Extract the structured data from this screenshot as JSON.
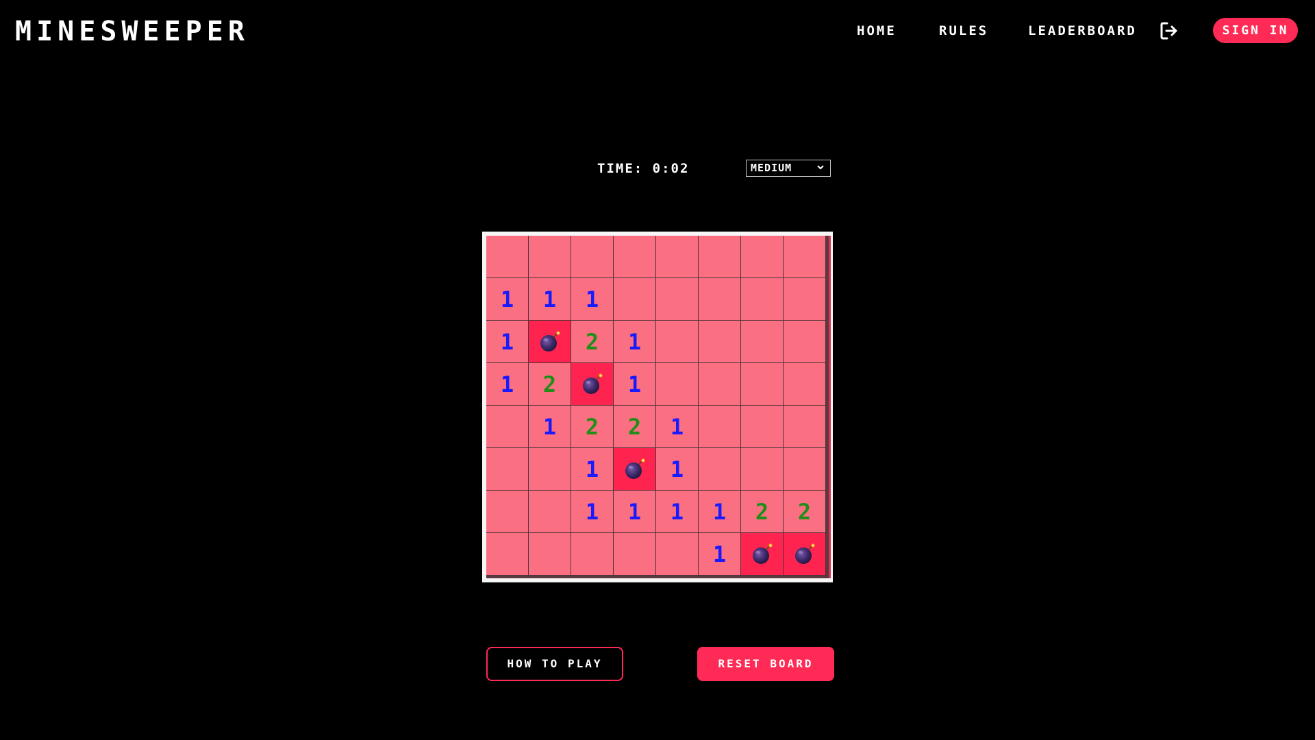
{
  "header": {
    "logo": "MINESWEEPER",
    "nav": {
      "home": "HOME",
      "rules": "RULES",
      "leaderboard": "LEADERBOARD"
    },
    "logout_icon": "logout-icon",
    "sign_in": "SIGN IN"
  },
  "game": {
    "timer": "TIME: 0:02",
    "difficulty": {
      "selected": "MEDIUM"
    },
    "board": {
      "rows": 8,
      "cols": 8,
      "cells": [
        [
          "",
          "",
          "",
          "",
          "",
          "",
          "",
          ""
        ],
        [
          "1",
          "1",
          "1",
          "",
          "",
          "",
          "",
          ""
        ],
        [
          "1",
          "*",
          "2",
          "1",
          "",
          "",
          "",
          ""
        ],
        [
          "1",
          "2",
          "*",
          "1",
          "",
          "",
          "",
          ""
        ],
        [
          "",
          "1",
          "2",
          "2",
          "1",
          "",
          "",
          ""
        ],
        [
          "",
          "",
          "1",
          "*",
          "1",
          "",
          "",
          ""
        ],
        [
          "",
          "",
          "1",
          "1",
          "1",
          "1",
          "2",
          "2"
        ],
        [
          "",
          "",
          "",
          "",
          "",
          "1",
          "*",
          "*"
        ]
      ]
    }
  },
  "actions": {
    "how_to_play": "HOW TO PLAY",
    "reset_board": "RESET BOARD"
  },
  "colors": {
    "accent": "#ff2a55",
    "cell": "#fb6f82",
    "mine_cell": "#ff2450",
    "number_1": "#1a1aff",
    "number_2": "#1f8f17",
    "background": "#000000"
  }
}
